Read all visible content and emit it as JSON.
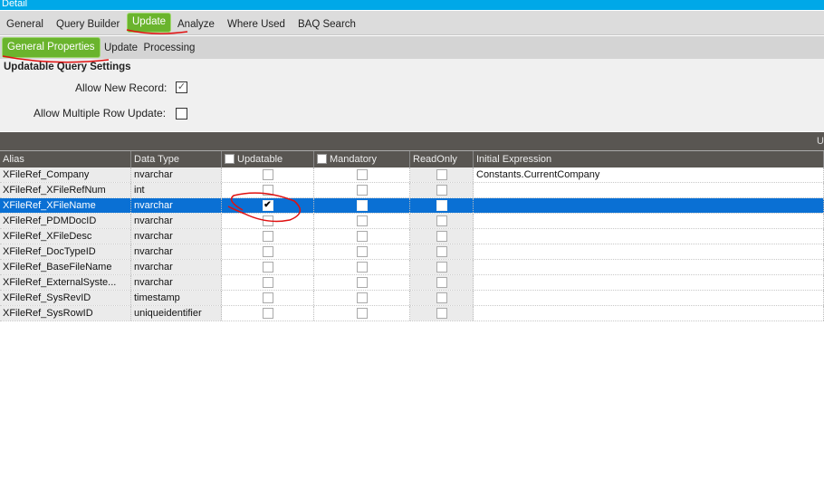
{
  "title": "Detail",
  "tabs": [
    {
      "label": "General"
    },
    {
      "label": "Query Builder"
    },
    {
      "label": "Update",
      "active": true
    },
    {
      "label": "Analyze"
    },
    {
      "label": "Where Used"
    },
    {
      "label": "BAQ Search"
    }
  ],
  "subtabs": [
    {
      "label": "General Properties",
      "active": true
    },
    {
      "label": "Update  Processing"
    }
  ],
  "settings": {
    "heading": "Updatable Query Settings",
    "allow_new_record": {
      "label": "Allow New Record:",
      "checked": true
    },
    "allow_multiple_row_update": {
      "label": "Allow Multiple Row Update:",
      "checked": false
    }
  },
  "darkbar_text": "U",
  "grid": {
    "columns": [
      "Alias",
      "Data Type",
      "Updatable",
      "Mandatory",
      "ReadOnly",
      "Initial Expression"
    ],
    "rows": [
      {
        "alias": "XFileRef_Company",
        "type": "nvarchar",
        "updatable": false,
        "mandatory": false,
        "readonly": false,
        "expr": "Constants.CurrentCompany"
      },
      {
        "alias": "XFileRef_XFileRefNum",
        "type": "int",
        "updatable": false,
        "mandatory": false,
        "readonly": false,
        "expr": ""
      },
      {
        "alias": "XFileRef_XFileName",
        "type": "nvarchar",
        "updatable": true,
        "mandatory": false,
        "readonly": false,
        "expr": "",
        "selected": true
      },
      {
        "alias": "XFileRef_PDMDocID",
        "type": "nvarchar",
        "updatable": false,
        "mandatory": false,
        "readonly": false,
        "expr": ""
      },
      {
        "alias": "XFileRef_XFileDesc",
        "type": "nvarchar",
        "updatable": false,
        "mandatory": false,
        "readonly": false,
        "expr": ""
      },
      {
        "alias": "XFileRef_DocTypeID",
        "type": "nvarchar",
        "updatable": false,
        "mandatory": false,
        "readonly": false,
        "expr": ""
      },
      {
        "alias": "XFileRef_BaseFileName",
        "type": "nvarchar",
        "updatable": false,
        "mandatory": false,
        "readonly": false,
        "expr": ""
      },
      {
        "alias": "XFileRef_ExternalSyste...",
        "type": "nvarchar",
        "updatable": false,
        "mandatory": false,
        "readonly": false,
        "expr": ""
      },
      {
        "alias": "XFileRef_SysRevID",
        "type": "timestamp",
        "updatable": false,
        "mandatory": false,
        "readonly": false,
        "expr": ""
      },
      {
        "alias": "XFileRef_SysRowID",
        "type": "uniqueidentifier",
        "updatable": false,
        "mandatory": false,
        "readonly": false,
        "expr": ""
      }
    ]
  },
  "colors": {
    "titlebar": "#00a8e8",
    "active_tab": "#6ab42d",
    "selected_row": "#0a70d4",
    "grid_header": "#595652",
    "annotation": "#e01010"
  }
}
